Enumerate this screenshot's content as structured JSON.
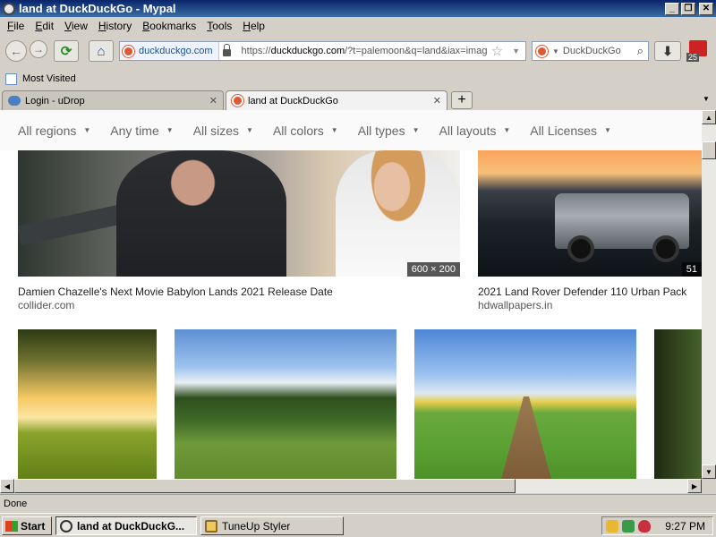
{
  "window": {
    "title": "land at DuckDuckGo - Mypal"
  },
  "menu": [
    "File",
    "Edit",
    "View",
    "History",
    "Bookmarks",
    "Tools",
    "Help"
  ],
  "address": {
    "identity": "duckduckgo.com",
    "url_prefix": "https://",
    "url_domain": "duckduckgo.com",
    "url_rest": "/?t=palemoon&q=land&iax=imag"
  },
  "search": {
    "engine": "DuckDuckGo"
  },
  "addon_badge": "25",
  "bookmarks": {
    "most_visited": "Most Visited"
  },
  "tabs": [
    {
      "title": "Login - uDrop"
    },
    {
      "title": "land at DuckDuckGo"
    }
  ],
  "filters": [
    "All regions",
    "Any time",
    "All sizes",
    "All colors",
    "All types",
    "All layouts",
    "All Licenses"
  ],
  "results": [
    {
      "title": "Damien Chazelle's Next Movie Babylon Lands 2021 Release Date",
      "source": "collider.com",
      "dims": "600 × 200"
    },
    {
      "title": "2021 Land Rover Defender 110 Urban Pack",
      "source": "hdwallpapers.in",
      "dims": "51"
    }
  ],
  "status": "Done",
  "taskbar": {
    "start": "Start",
    "tasks": [
      "land at DuckDuckG...",
      "TuneUp Styler"
    ],
    "clock": "9:27 PM"
  }
}
